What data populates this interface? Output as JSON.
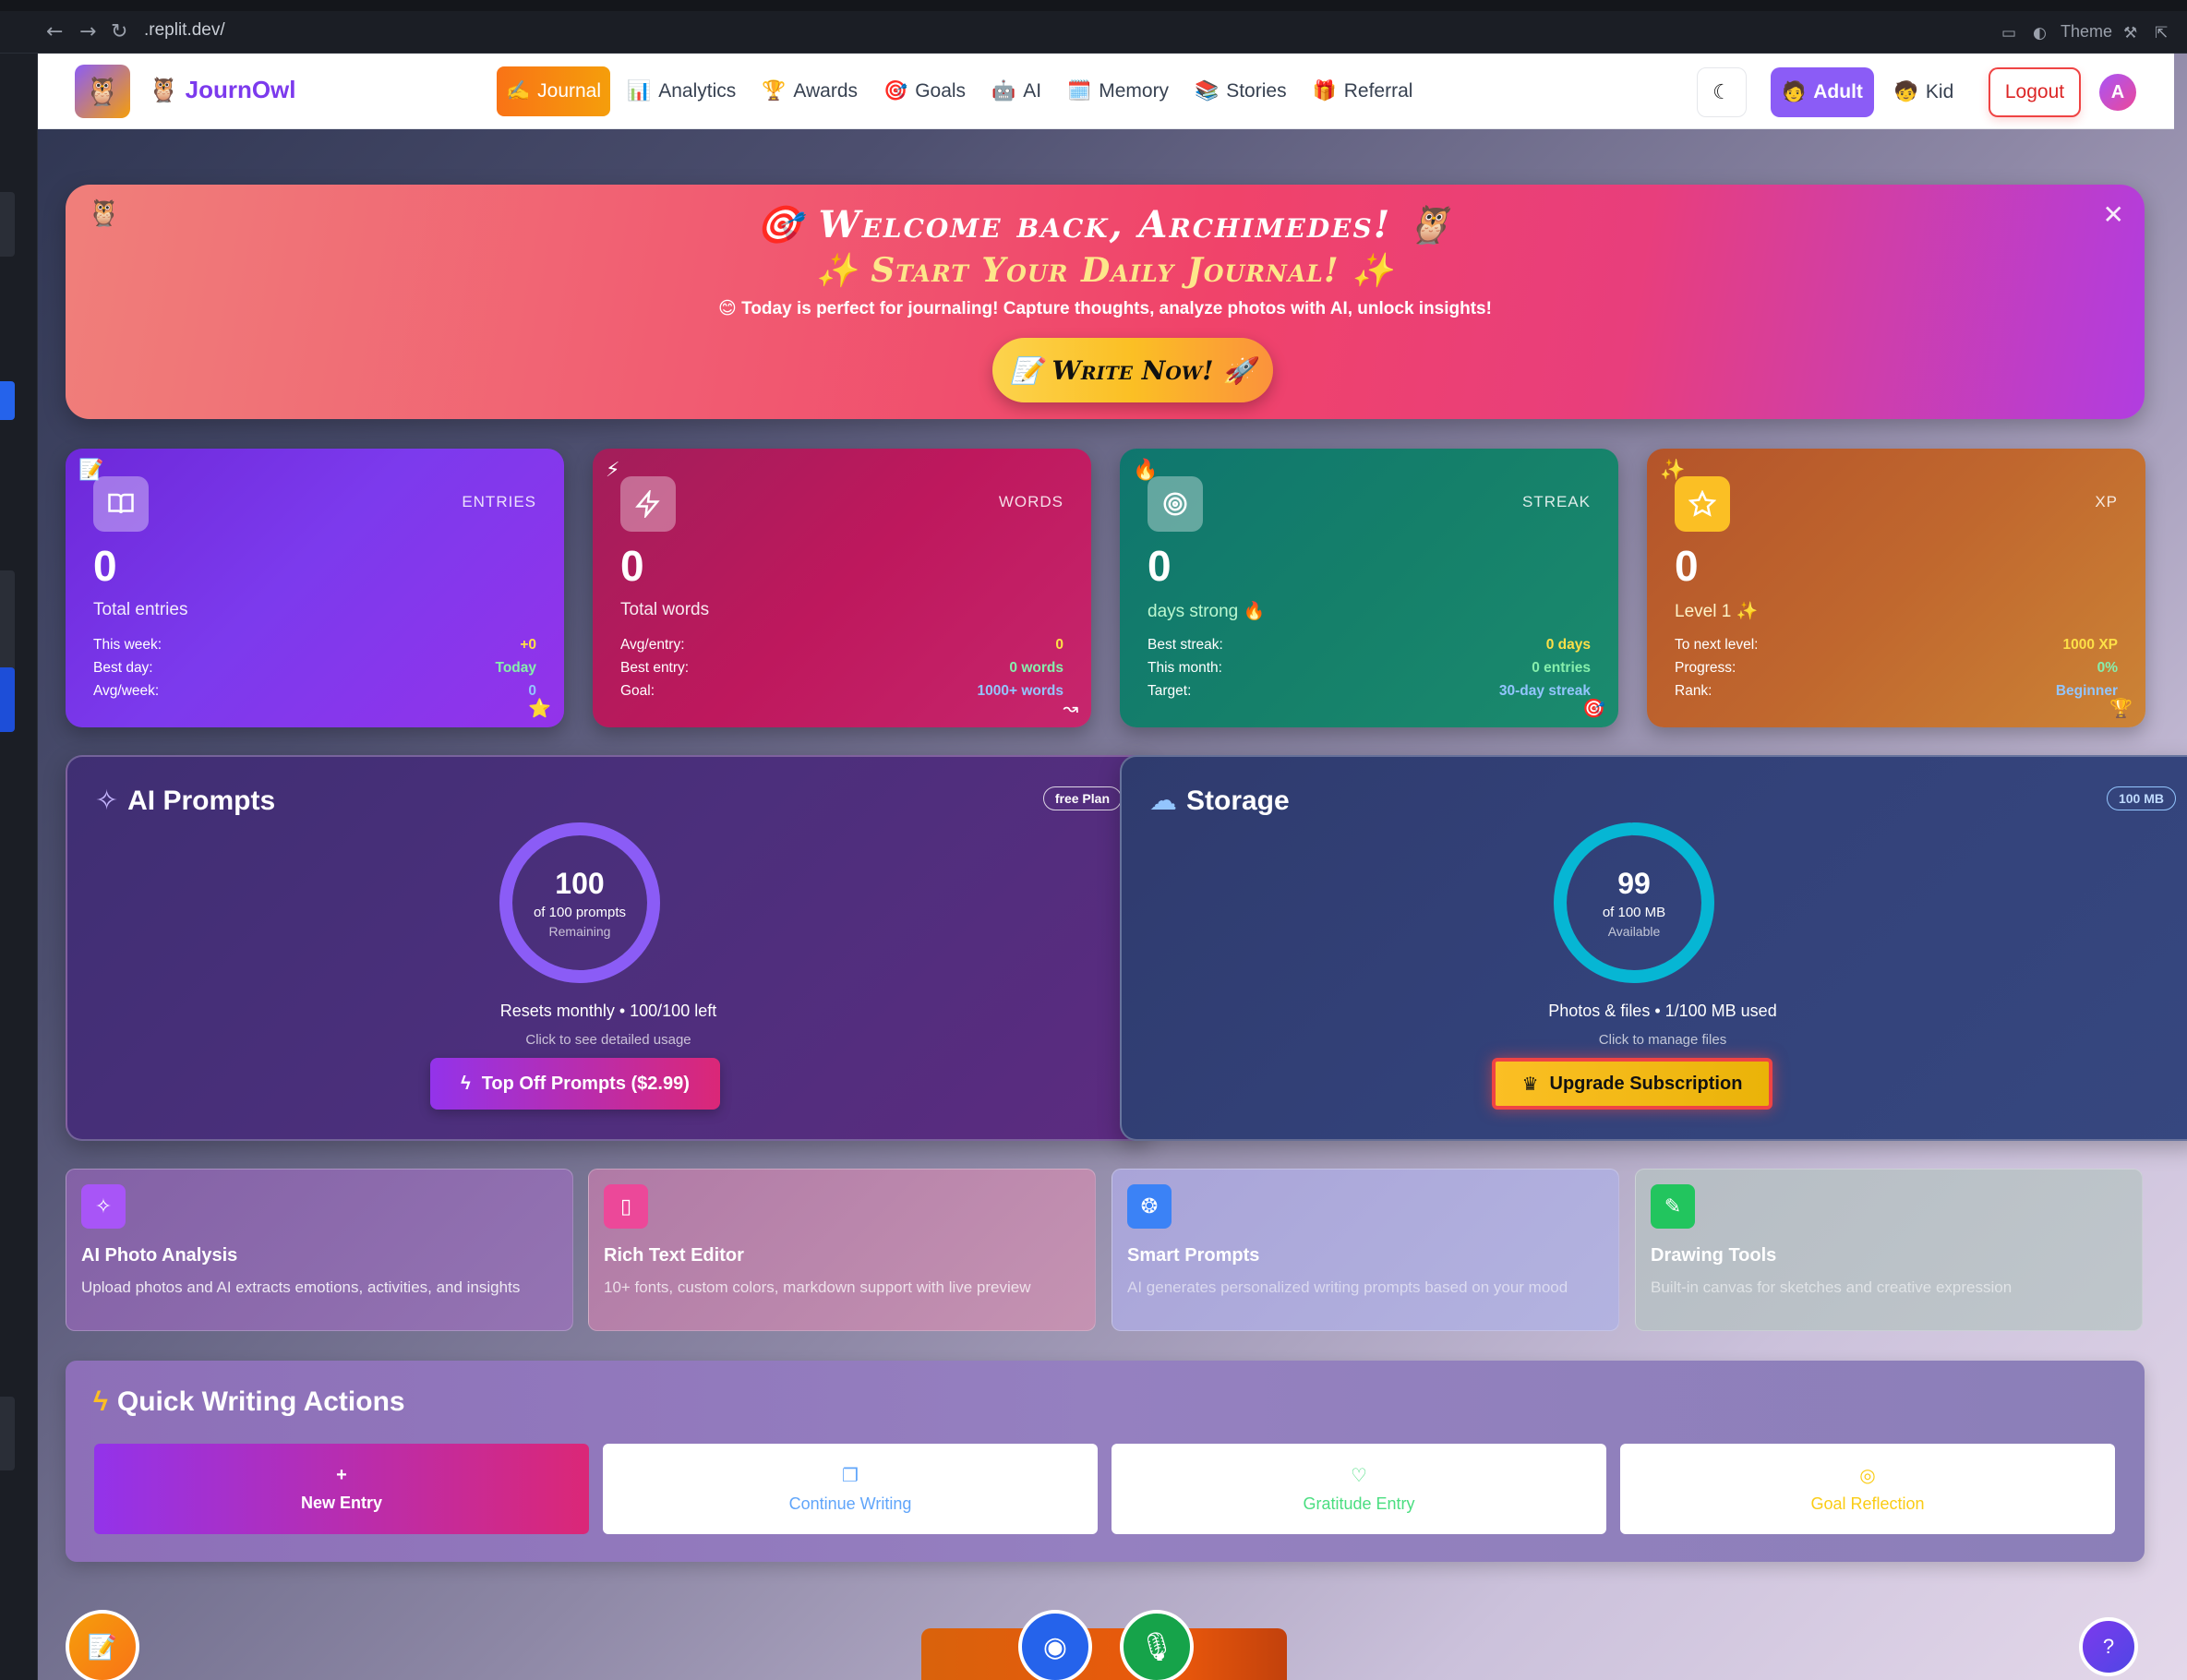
{
  "browser": {
    "url": ".replit.dev/",
    "theme_label": "Theme"
  },
  "nav": {
    "brand": "JournOwl",
    "brand_icon": "🦉",
    "items": [
      {
        "icon": "✍️",
        "label": "Journal",
        "active": true
      },
      {
        "icon": "📊",
        "label": "Analytics"
      },
      {
        "icon": "🏆",
        "label": "Awards"
      },
      {
        "icon": "🎯",
        "label": "Goals"
      },
      {
        "icon": "🤖",
        "label": "AI"
      },
      {
        "icon": "🗓️",
        "label": "Memory"
      },
      {
        "icon": "📚",
        "label": "Stories"
      },
      {
        "icon": "🎁",
        "label": "Referral"
      }
    ],
    "adult_label": "Adult",
    "kid_label": "Kid",
    "logout_label": "Logout",
    "avatar_initial": "A"
  },
  "banner": {
    "title": "Welcome back, Archimedes!",
    "subtitle": "Start Your Daily Journal!",
    "message": "😊 Today is perfect for journaling! Capture thoughts, analyze photos with AI, unlock insights!",
    "cta": "Write Now!"
  },
  "stats": [
    {
      "label": "ENTRIES",
      "value": "0",
      "caption": "Total entries",
      "rows": [
        [
          "This week:",
          "+0"
        ],
        [
          "Best day:",
          "Today"
        ],
        [
          "Avg/week:",
          "0"
        ]
      ]
    },
    {
      "label": "WORDS",
      "value": "0",
      "caption": "Total words",
      "rows": [
        [
          "Avg/entry:",
          "0"
        ],
        [
          "Best entry:",
          "0 words"
        ],
        [
          "Goal:",
          "1000+ words"
        ]
      ]
    },
    {
      "label": "STREAK",
      "value": "0",
      "caption": "days strong 🔥",
      "rows": [
        [
          "Best streak:",
          "0 days"
        ],
        [
          "This month:",
          "0 entries"
        ],
        [
          "Target:",
          "30-day streak"
        ]
      ]
    },
    {
      "label": "XP",
      "value": "0",
      "caption": "Level 1 ✨",
      "rows": [
        [
          "To next level:",
          "1000 XP"
        ],
        [
          "Progress:",
          "0%"
        ],
        [
          "Rank:",
          "Beginner"
        ]
      ]
    }
  ],
  "ai_prompts": {
    "title": "AI Prompts",
    "plan": "free Plan",
    "remaining": "100",
    "of_text": "of 100 prompts",
    "state": "Remaining",
    "info": "Resets monthly • 100/100 left",
    "hint": "Click to see detailed usage",
    "button": "Top Off Prompts ($2.99)",
    "fraction": 1.0
  },
  "storage": {
    "title": "Storage",
    "plan": "100 MB",
    "available": "99",
    "of_text": "of 100 MB",
    "state": "Available",
    "info": "Photos & files • 1/100 MB used",
    "hint": "Click to manage files",
    "button": "Upgrade Subscription",
    "fraction": 0.99
  },
  "features": [
    {
      "title": "AI Photo Analysis",
      "desc": "Upload photos and AI extracts emotions, activities, and insights"
    },
    {
      "title": "Rich Text Editor",
      "desc": "10+ fonts, custom colors, markdown support with live preview"
    },
    {
      "title": "Smart Prompts",
      "desc": "AI generates personalized writing prompts based on your mood"
    },
    {
      "title": "Drawing Tools",
      "desc": "Built-in canvas for sketches and creative expression"
    }
  ],
  "quick": {
    "title": "Quick Writing Actions",
    "actions": [
      {
        "icon": "+",
        "label": "New Entry"
      },
      {
        "icon": "📖",
        "label": "Continue Writing"
      },
      {
        "icon": "♡",
        "label": "Gratitude Entry"
      },
      {
        "icon": "◎",
        "label": "Goal Reflection"
      }
    ]
  },
  "colors": {
    "accent": "#8b5cf6",
    "orange": "#f97316",
    "yellow": "#fbbf24",
    "pink": "#db2777",
    "cyan": "#06b6d4"
  }
}
